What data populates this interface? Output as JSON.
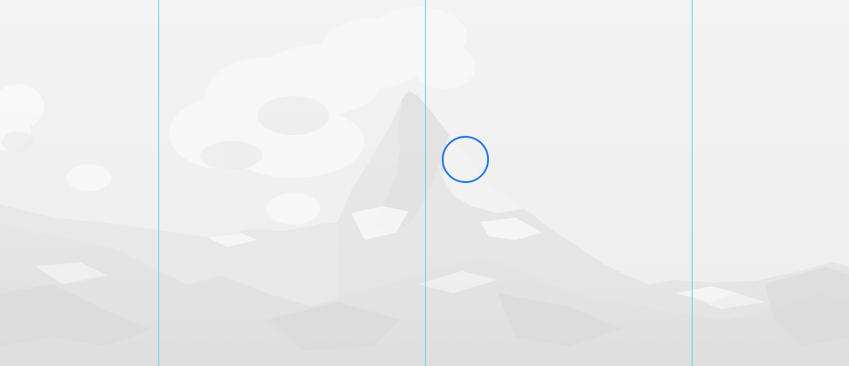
{
  "scene": {
    "subject": "mountain-photo",
    "tint": "#f2f2f2"
  },
  "overlay": {
    "guide_color": "#5fd9e0",
    "ring_color": "#1a73e8",
    "guide_count": 3
  }
}
